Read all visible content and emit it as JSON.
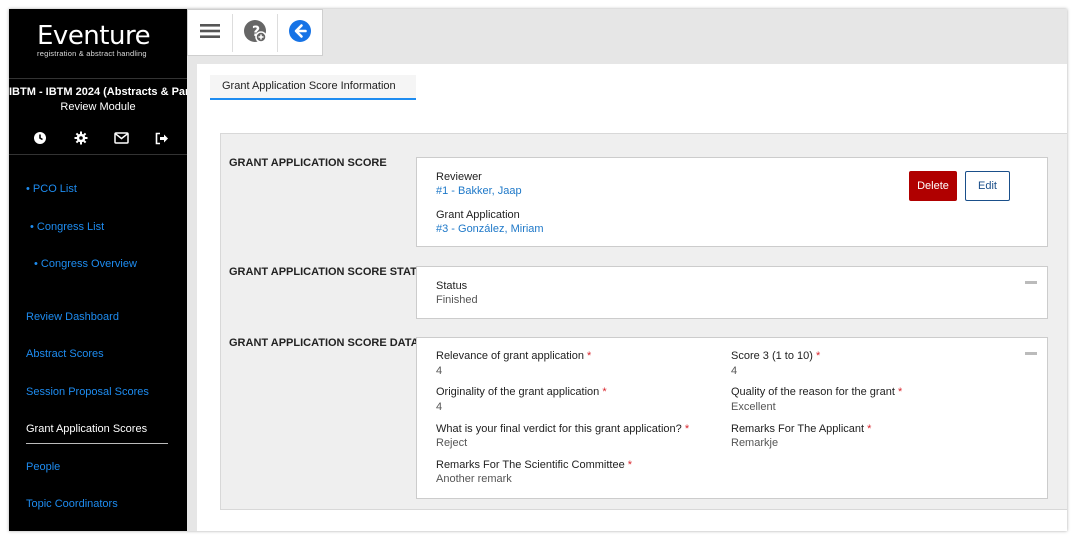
{
  "app": {
    "logo_main": "Eventure",
    "logo_sub": "registration & abstract handling"
  },
  "sidebar": {
    "event_title": "IBTM - IBTM 2024 (Abstracts & Par...",
    "module": "Review Module",
    "icons": [
      "clock-icon",
      "gear-icon",
      "mail-icon",
      "logout-icon"
    ],
    "items": [
      {
        "label": "• PCO List"
      },
      {
        "label": "• Congress List"
      },
      {
        "label": "• Congress Overview"
      },
      {
        "label": "Review Dashboard"
      },
      {
        "label": "Abstract Scores"
      },
      {
        "label": "Session Proposal Scores"
      },
      {
        "label": "Grant Application Scores"
      },
      {
        "label": "People"
      },
      {
        "label": "Topic Coordinators"
      }
    ],
    "active_item": "Grant Application Scores"
  },
  "toolbar": {
    "icons": [
      "menu-icon",
      "help-icon",
      "back-icon"
    ]
  },
  "page": {
    "tab_label": "Grant Application Score Information"
  },
  "sections": {
    "score": {
      "title": "GRANT APPLICATION SCORE",
      "reviewer_label": "Reviewer",
      "reviewer_value": "#1 - Bakker, Jaap",
      "application_label": "Grant Application",
      "application_value": "#3 - González, Miriam",
      "delete_label": "Delete",
      "edit_label": "Edit"
    },
    "status": {
      "title": "GRANT APPLICATION SCORE STATUS",
      "status_label": "Status",
      "status_value": "Finished"
    },
    "data": {
      "title": "GRANT APPLICATION SCORE DATA",
      "fields": [
        {
          "label": "Relevance of grant application",
          "value": "4"
        },
        {
          "label": "Score 3 (1 to 10)",
          "value": "4"
        },
        {
          "label": "Originality of the grant application",
          "value": "4"
        },
        {
          "label": "Quality of the reason for the grant",
          "value": "Excellent"
        },
        {
          "label": "What is your final verdict for this grant application?",
          "value": "Reject"
        },
        {
          "label": "Remarks For The Applicant",
          "value": "Remarkje"
        },
        {
          "label": "Remarks For The Scientific Committee",
          "value": "Another remark"
        }
      ],
      "required_marker": "*"
    }
  },
  "colors": {
    "accent": "#1e8cf0",
    "delete": "#b00000",
    "sidebar_bg": "#000000"
  }
}
